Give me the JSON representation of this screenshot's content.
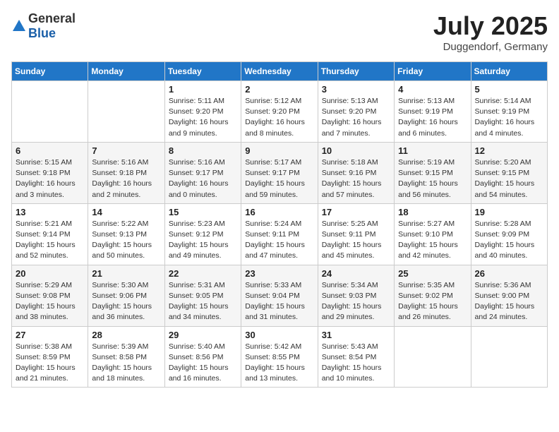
{
  "header": {
    "logo_general": "General",
    "logo_blue": "Blue",
    "month": "July 2025",
    "location": "Duggendorf, Germany"
  },
  "days_of_week": [
    "Sunday",
    "Monday",
    "Tuesday",
    "Wednesday",
    "Thursday",
    "Friday",
    "Saturday"
  ],
  "weeks": [
    [
      {
        "day": "",
        "info": ""
      },
      {
        "day": "",
        "info": ""
      },
      {
        "day": "1",
        "info": "Sunrise: 5:11 AM\nSunset: 9:20 PM\nDaylight: 16 hours\nand 9 minutes."
      },
      {
        "day": "2",
        "info": "Sunrise: 5:12 AM\nSunset: 9:20 PM\nDaylight: 16 hours\nand 8 minutes."
      },
      {
        "day": "3",
        "info": "Sunrise: 5:13 AM\nSunset: 9:20 PM\nDaylight: 16 hours\nand 7 minutes."
      },
      {
        "day": "4",
        "info": "Sunrise: 5:13 AM\nSunset: 9:19 PM\nDaylight: 16 hours\nand 6 minutes."
      },
      {
        "day": "5",
        "info": "Sunrise: 5:14 AM\nSunset: 9:19 PM\nDaylight: 16 hours\nand 4 minutes."
      }
    ],
    [
      {
        "day": "6",
        "info": "Sunrise: 5:15 AM\nSunset: 9:18 PM\nDaylight: 16 hours\nand 3 minutes."
      },
      {
        "day": "7",
        "info": "Sunrise: 5:16 AM\nSunset: 9:18 PM\nDaylight: 16 hours\nand 2 minutes."
      },
      {
        "day": "8",
        "info": "Sunrise: 5:16 AM\nSunset: 9:17 PM\nDaylight: 16 hours\nand 0 minutes."
      },
      {
        "day": "9",
        "info": "Sunrise: 5:17 AM\nSunset: 9:17 PM\nDaylight: 15 hours\nand 59 minutes."
      },
      {
        "day": "10",
        "info": "Sunrise: 5:18 AM\nSunset: 9:16 PM\nDaylight: 15 hours\nand 57 minutes."
      },
      {
        "day": "11",
        "info": "Sunrise: 5:19 AM\nSunset: 9:15 PM\nDaylight: 15 hours\nand 56 minutes."
      },
      {
        "day": "12",
        "info": "Sunrise: 5:20 AM\nSunset: 9:15 PM\nDaylight: 15 hours\nand 54 minutes."
      }
    ],
    [
      {
        "day": "13",
        "info": "Sunrise: 5:21 AM\nSunset: 9:14 PM\nDaylight: 15 hours\nand 52 minutes."
      },
      {
        "day": "14",
        "info": "Sunrise: 5:22 AM\nSunset: 9:13 PM\nDaylight: 15 hours\nand 50 minutes."
      },
      {
        "day": "15",
        "info": "Sunrise: 5:23 AM\nSunset: 9:12 PM\nDaylight: 15 hours\nand 49 minutes."
      },
      {
        "day": "16",
        "info": "Sunrise: 5:24 AM\nSunset: 9:11 PM\nDaylight: 15 hours\nand 47 minutes."
      },
      {
        "day": "17",
        "info": "Sunrise: 5:25 AM\nSunset: 9:11 PM\nDaylight: 15 hours\nand 45 minutes."
      },
      {
        "day": "18",
        "info": "Sunrise: 5:27 AM\nSunset: 9:10 PM\nDaylight: 15 hours\nand 42 minutes."
      },
      {
        "day": "19",
        "info": "Sunrise: 5:28 AM\nSunset: 9:09 PM\nDaylight: 15 hours\nand 40 minutes."
      }
    ],
    [
      {
        "day": "20",
        "info": "Sunrise: 5:29 AM\nSunset: 9:08 PM\nDaylight: 15 hours\nand 38 minutes."
      },
      {
        "day": "21",
        "info": "Sunrise: 5:30 AM\nSunset: 9:06 PM\nDaylight: 15 hours\nand 36 minutes."
      },
      {
        "day": "22",
        "info": "Sunrise: 5:31 AM\nSunset: 9:05 PM\nDaylight: 15 hours\nand 34 minutes."
      },
      {
        "day": "23",
        "info": "Sunrise: 5:33 AM\nSunset: 9:04 PM\nDaylight: 15 hours\nand 31 minutes."
      },
      {
        "day": "24",
        "info": "Sunrise: 5:34 AM\nSunset: 9:03 PM\nDaylight: 15 hours\nand 29 minutes."
      },
      {
        "day": "25",
        "info": "Sunrise: 5:35 AM\nSunset: 9:02 PM\nDaylight: 15 hours\nand 26 minutes."
      },
      {
        "day": "26",
        "info": "Sunrise: 5:36 AM\nSunset: 9:00 PM\nDaylight: 15 hours\nand 24 minutes."
      }
    ],
    [
      {
        "day": "27",
        "info": "Sunrise: 5:38 AM\nSunset: 8:59 PM\nDaylight: 15 hours\nand 21 minutes."
      },
      {
        "day": "28",
        "info": "Sunrise: 5:39 AM\nSunset: 8:58 PM\nDaylight: 15 hours\nand 18 minutes."
      },
      {
        "day": "29",
        "info": "Sunrise: 5:40 AM\nSunset: 8:56 PM\nDaylight: 15 hours\nand 16 minutes."
      },
      {
        "day": "30",
        "info": "Sunrise: 5:42 AM\nSunset: 8:55 PM\nDaylight: 15 hours\nand 13 minutes."
      },
      {
        "day": "31",
        "info": "Sunrise: 5:43 AM\nSunset: 8:54 PM\nDaylight: 15 hours\nand 10 minutes."
      },
      {
        "day": "",
        "info": ""
      },
      {
        "day": "",
        "info": ""
      }
    ]
  ]
}
